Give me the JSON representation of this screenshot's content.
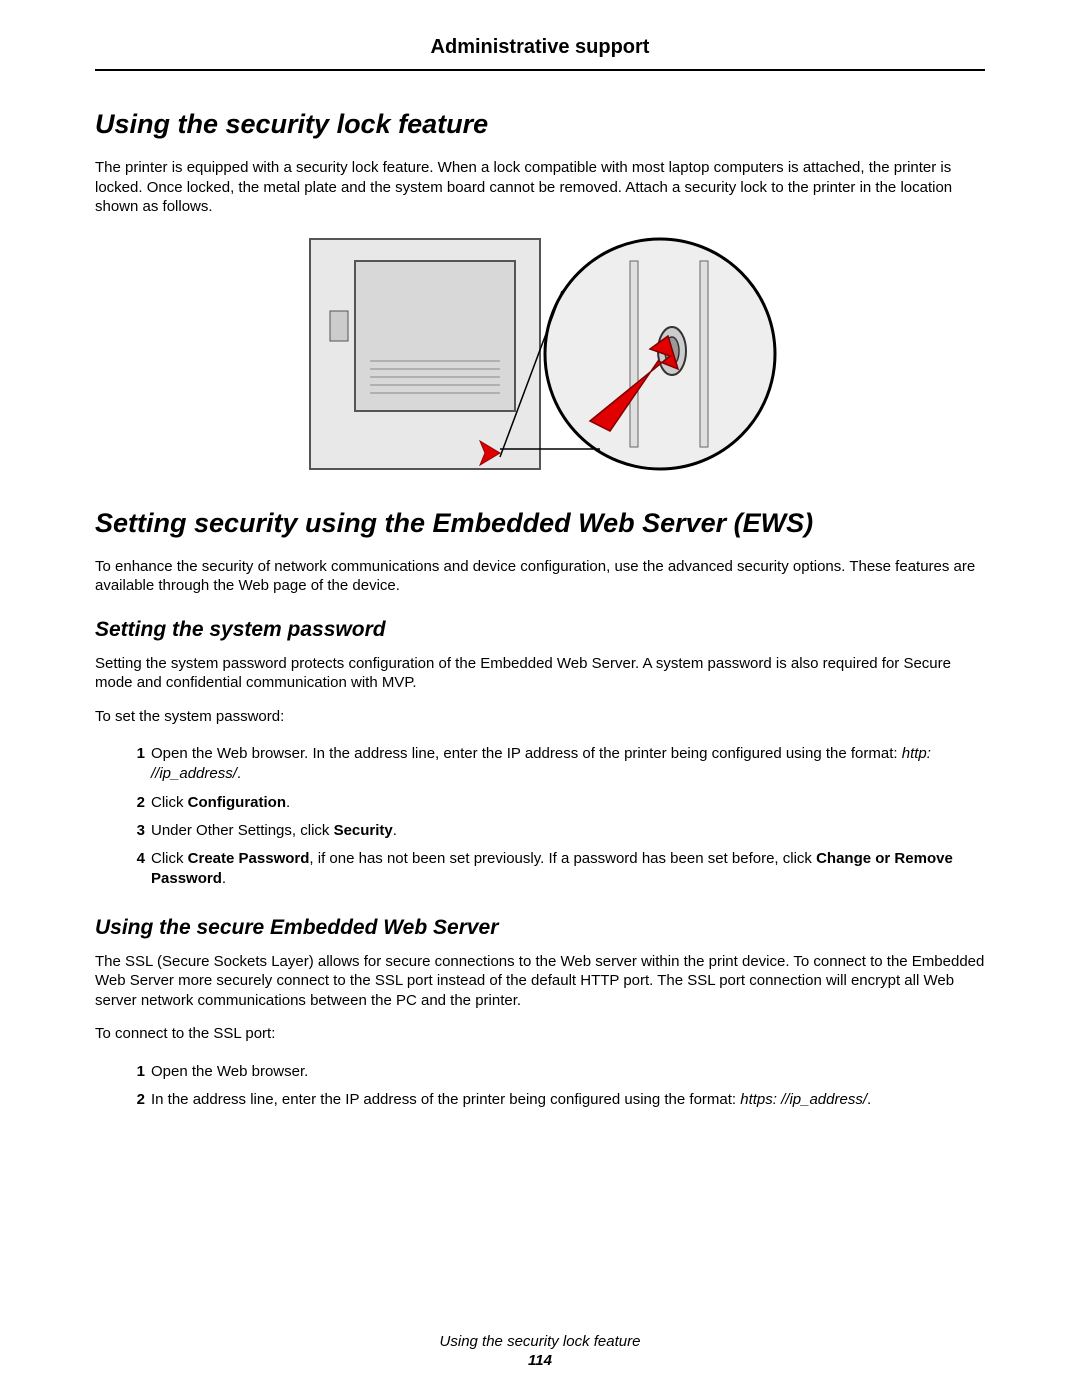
{
  "header": {
    "title": "Administrative support"
  },
  "section1": {
    "heading": "Using the security lock feature",
    "paragraph": "The printer is equipped with a security lock feature. When a lock compatible with most laptop computers is attached, the printer is locked. Once locked, the metal plate and the system board cannot be removed. Attach a security lock to the printer in the location shown as follows."
  },
  "section2": {
    "heading": "Setting security using the Embedded Web Server (EWS)",
    "paragraph": "To enhance the security of network communications and device configuration, use the advanced security options. These features are available through the Web page of the device."
  },
  "sub1": {
    "heading": "Setting the system password",
    "paragraph": "Setting the system password protects configuration of the Embedded Web Server. A system password is also required for Secure mode and confidential communication with MVP.",
    "intro": "To set the system password:",
    "step1_a": "Open the Web browser. In the address line, enter the IP address of the printer being configured using the format: ",
    "step1_b": "http: //ip_address/",
    "step1_c": ".",
    "step2_a": "Click ",
    "step2_b": "Configuration",
    "step2_c": ".",
    "step3_a": "Under Other Settings, click ",
    "step3_b": "Security",
    "step3_c": ".",
    "step4_a": "Click ",
    "step4_b": "Create Password",
    "step4_c": ", if one has not been set previously. If a password has been set before, click ",
    "step4_d": "Change or Remove Password",
    "step4_e": "."
  },
  "sub2": {
    "heading": "Using the secure Embedded Web Server",
    "paragraph": "The SSL (Secure Sockets Layer) allows for secure connections to the Web server within the print device. To connect to the Embedded Web Server more securely connect to the SSL port instead of the default HTTP port. The SSL port connection will encrypt all Web server network communications between the PC and the printer.",
    "intro": "To connect to the SSL port:",
    "step1": "Open the Web browser.",
    "step2_a": "In the address line, enter the IP address of the printer being configured using the format: ",
    "step2_b": "https: //ip_address/",
    "step2_c": "."
  },
  "footer": {
    "caption": "Using the security lock feature",
    "page": "114"
  }
}
